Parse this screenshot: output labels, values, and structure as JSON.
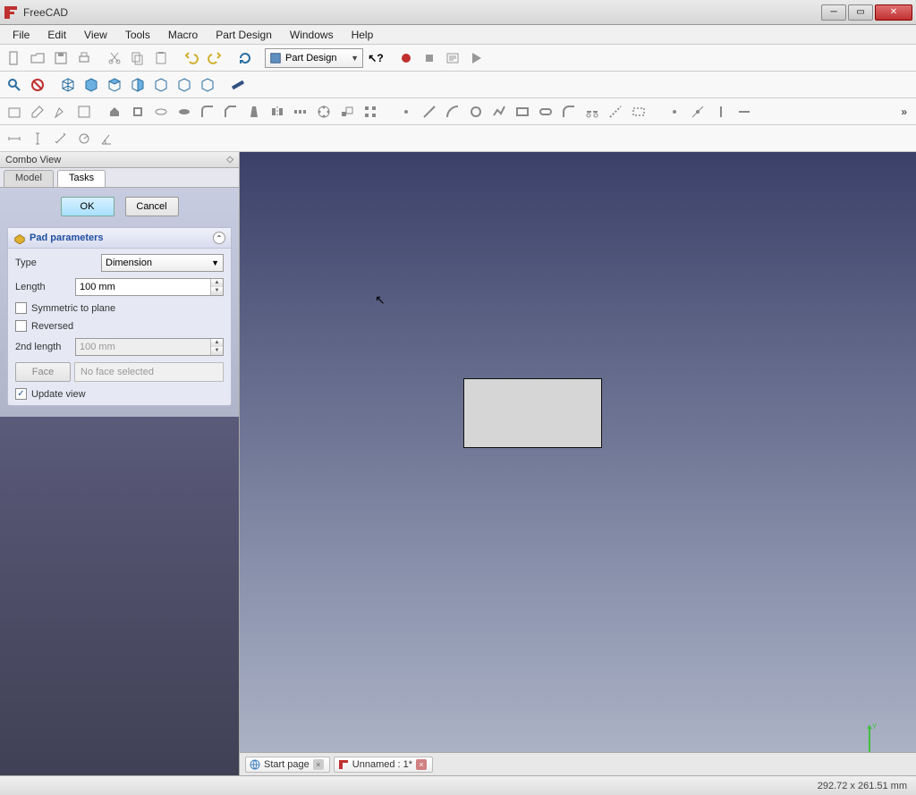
{
  "window": {
    "title": "FreeCAD"
  },
  "menu": {
    "items": [
      "File",
      "Edit",
      "View",
      "Tools",
      "Macro",
      "Part Design",
      "Windows",
      "Help"
    ]
  },
  "workbench": {
    "selected": "Part Design"
  },
  "combo": {
    "title": "Combo View",
    "tabs": {
      "model": "Model",
      "tasks": "Tasks"
    },
    "active_tab": "Tasks",
    "buttons": {
      "ok": "OK",
      "cancel": "Cancel"
    }
  },
  "pad": {
    "title": "Pad parameters",
    "type_label": "Type",
    "type_value": "Dimension",
    "length_label": "Length",
    "length_value": "100 mm",
    "symmetric_label": "Symmetric to plane",
    "symmetric_checked": false,
    "reversed_label": "Reversed",
    "reversed_checked": false,
    "second_length_label": "2nd length",
    "second_length_value": "100 mm",
    "face_button": "Face",
    "face_text": "No face selected",
    "update_view_label": "Update view",
    "update_view_checked": true
  },
  "doc_tabs": {
    "start": "Start page",
    "unnamed": "Unnamed : 1*"
  },
  "status": {
    "pos": "292.72 x 261.51 mm"
  }
}
